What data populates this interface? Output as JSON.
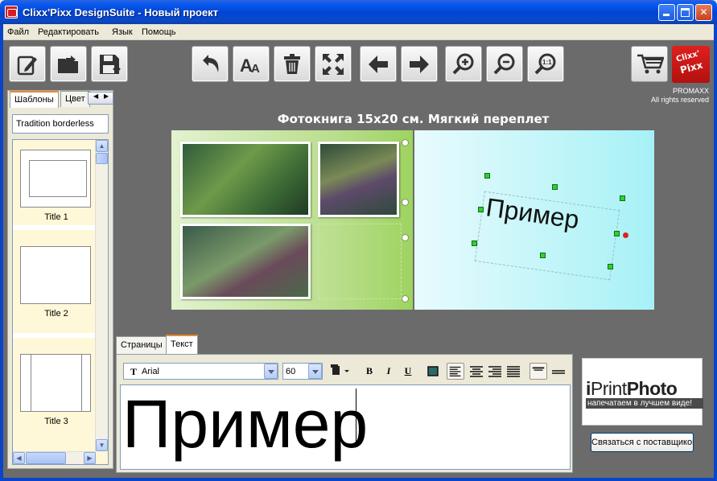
{
  "window": {
    "title": "Clixx'Pixx DesignSuite - Новый проект"
  },
  "menu": [
    {
      "label": "Файл"
    },
    {
      "label": "Редактировать"
    },
    {
      "label": "Язык"
    },
    {
      "label": "Помощь"
    }
  ],
  "toolbar": {
    "buttons": [
      "new-project",
      "open-project",
      "save-project",
      "undo",
      "text",
      "delete",
      "fit",
      "previous",
      "next",
      "zoom-in",
      "zoom-out",
      "zoom-actual"
    ],
    "logo_line1": "Clixx'",
    "logo_line2": "Pixx",
    "brand_name": "PROMAXX",
    "brand_rights": "All rights reserved"
  },
  "left_panel": {
    "tabs": [
      {
        "label": "Шаблоны"
      },
      {
        "label": "Цвет"
      }
    ],
    "selected_template": "Tradition borderless",
    "templates": [
      {
        "label": "Title 1"
      },
      {
        "label": "Title 2"
      },
      {
        "label": "Title 3"
      }
    ]
  },
  "canvas": {
    "page_title": "Фотокнига 15х20 см. Мягкий переплет",
    "text_frame_text": "Пример",
    "colors": {
      "left_page": "#b8dd8a",
      "right_page": "#a6f1f6",
      "handle": "#2fd12f",
      "rotate_handle": "#e02020"
    }
  },
  "bottom": {
    "tabs": [
      {
        "label": "Страницы"
      },
      {
        "label": "Текст"
      }
    ],
    "font": "Arial",
    "size": "60",
    "bold": "B",
    "italic": "I",
    "underline": "U",
    "text_value": "Пример"
  },
  "supplier": {
    "logo_i": "i",
    "logo_print": "Print",
    "logo_photo": "Photo",
    "tagline": "напечатаем в лучшем виде!",
    "contact_button": "Связаться с поставщиком"
  }
}
